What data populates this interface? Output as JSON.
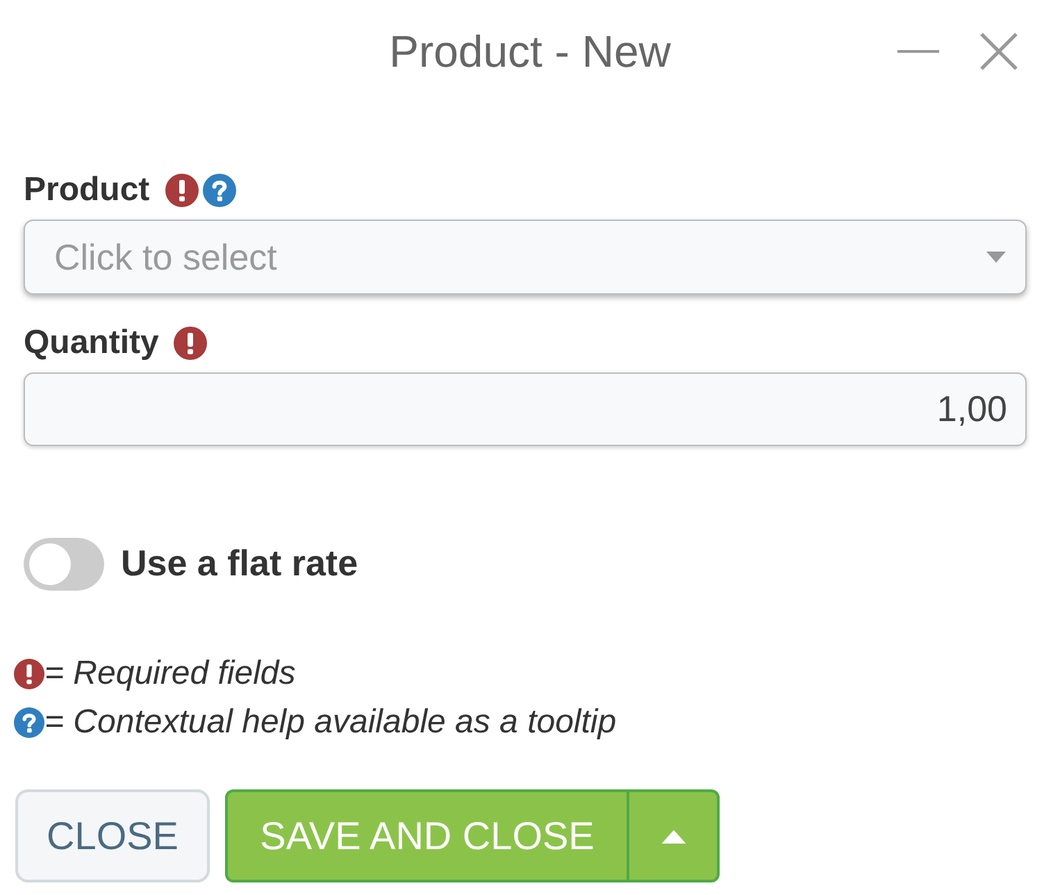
{
  "window": {
    "title": "Product - New"
  },
  "fields": [
    {
      "kind": "select",
      "label": "Product",
      "required": true,
      "help": true,
      "placeholder": "Click to select"
    },
    {
      "kind": "number",
      "label": "Quantity",
      "required": true,
      "help": false,
      "value": "1,00"
    }
  ],
  "toggle": {
    "label": "Use a flat rate",
    "on": false
  },
  "legend": [
    {
      "kind": "required",
      "text": "= Required fields"
    },
    {
      "kind": "help",
      "text": "= Contextual help available as a tooltip"
    }
  ],
  "buttons": [
    {
      "kind": "secondary",
      "label": "CLOSE",
      "menu": false
    },
    {
      "kind": "primary",
      "label": "SAVE AND CLOSE",
      "menu": true
    }
  ]
}
